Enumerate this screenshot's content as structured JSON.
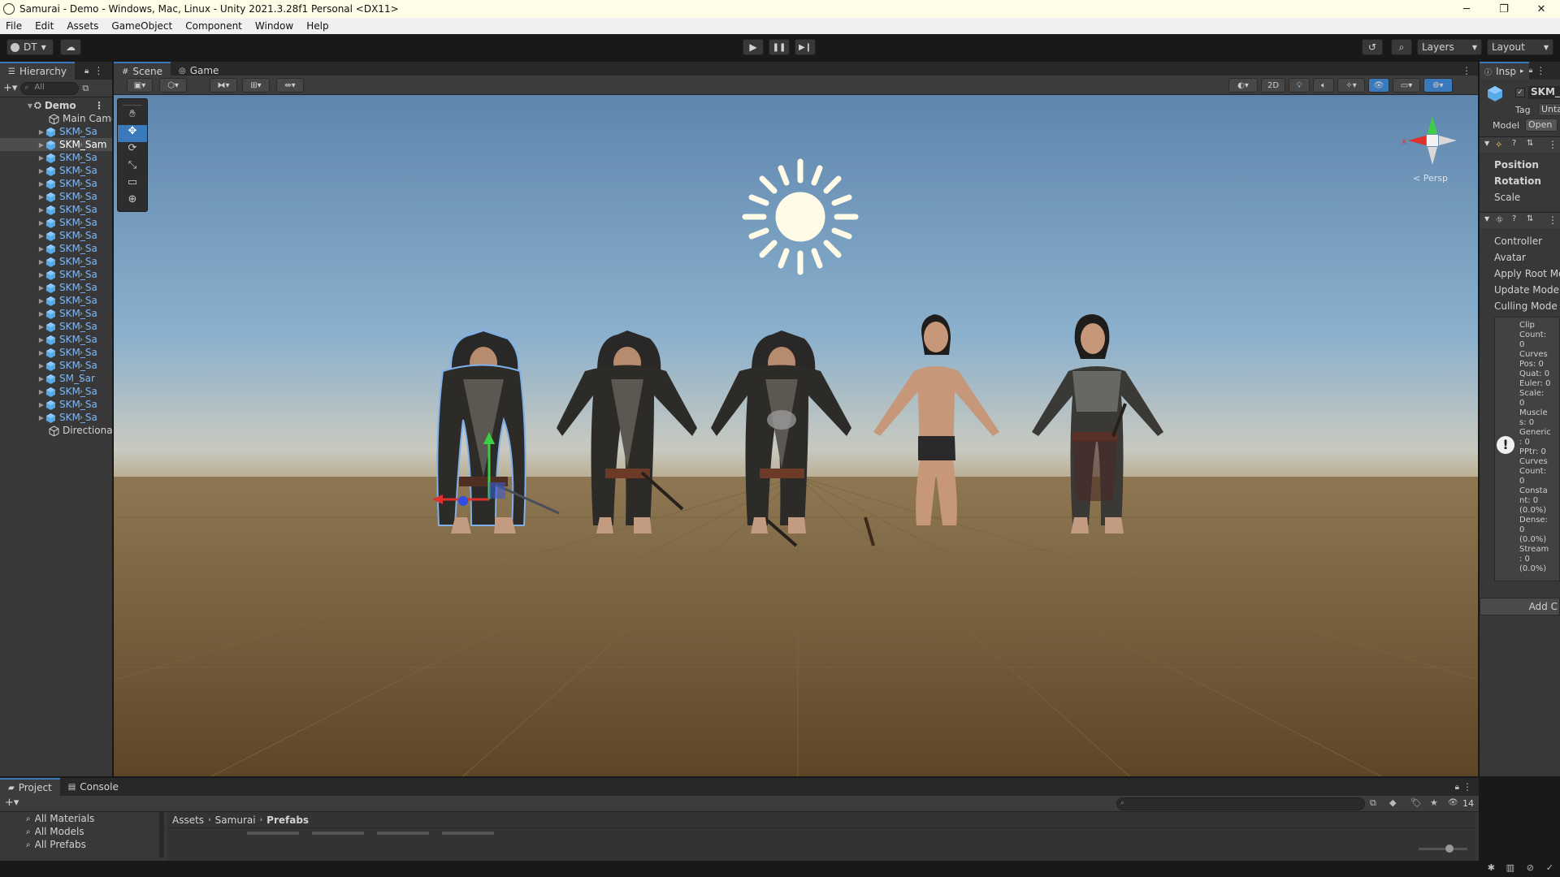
{
  "window": {
    "title": "Samurai - Demo - Windows, Mac, Linux - Unity 2021.3.28f1 Personal <DX11>",
    "controls": [
      "─",
      "❐",
      "✕"
    ]
  },
  "menu": [
    "File",
    "Edit",
    "Assets",
    "GameObject",
    "Component",
    "Window",
    "Help"
  ],
  "toolbar": {
    "account": "DT",
    "layers_label": "Layers",
    "layout_label": "Layout"
  },
  "hierarchy": {
    "tab": "Hierarchy",
    "search_placeholder": "All",
    "root": "Demo",
    "items": [
      {
        "label": "Main Came",
        "type": "object"
      },
      {
        "label": "SKM_Sa",
        "type": "prefab"
      },
      {
        "label": "SKM_Sam",
        "type": "prefab",
        "selected": true
      },
      {
        "label": "SKM_Sa",
        "type": "prefab"
      },
      {
        "label": "SKM_Sa",
        "type": "prefab"
      },
      {
        "label": "SKM_Sa",
        "type": "prefab"
      },
      {
        "label": "SKM_Sa",
        "type": "prefab"
      },
      {
        "label": "SKM_Sa",
        "type": "prefab"
      },
      {
        "label": "SKM_Sa",
        "type": "prefab"
      },
      {
        "label": "SKM_Sa",
        "type": "prefab"
      },
      {
        "label": "SKM_Sa",
        "type": "prefab"
      },
      {
        "label": "SKM_Sa",
        "type": "prefab"
      },
      {
        "label": "SKM_Sa",
        "type": "prefab"
      },
      {
        "label": "SKM_Sa",
        "type": "prefab"
      },
      {
        "label": "SKM_Sa",
        "type": "prefab"
      },
      {
        "label": "SKM_Sa",
        "type": "prefab"
      },
      {
        "label": "SKM_Sa",
        "type": "prefab"
      },
      {
        "label": "SKM_Sa",
        "type": "prefab"
      },
      {
        "label": "SKM_Sa",
        "type": "prefab"
      },
      {
        "label": "SKM_Sa",
        "type": "prefab"
      },
      {
        "label": "SM_Sar",
        "type": "prefab"
      },
      {
        "label": "SKM_Sa",
        "type": "prefab"
      },
      {
        "label": "SKM_Sa",
        "type": "prefab"
      },
      {
        "label": "SKM_Sa",
        "type": "prefab"
      },
      {
        "label": "Directiona",
        "type": "object"
      }
    ]
  },
  "scene": {
    "tabs": [
      "Scene",
      "Game"
    ],
    "toggle_2d": "2D",
    "persp_label": "< Persp",
    "gizmo_axis": "x"
  },
  "inspector": {
    "tab": "Insp",
    "object_name": "SKM_",
    "tag_label": "Tag",
    "tag_value": "Unta",
    "model_label": "Model",
    "model_button": "Open",
    "transform": [
      "Position",
      "Rotation",
      "Scale"
    ],
    "animator": [
      "Controller",
      "Avatar",
      "Apply Root Mo",
      "Update Mode",
      "Culling Mode"
    ],
    "clip_info": [
      "Clip",
      "Count:",
      "0",
      "Curves",
      "Pos: 0",
      "Quat: 0",
      "Euler: 0",
      "Scale:",
      "0",
      "Muscle",
      "s: 0",
      "Generic",
      ": 0",
      "PPtr: 0",
      "Curves",
      "Count:",
      "0",
      "Consta",
      "nt: 0",
      "(0.0%)",
      "Dense:",
      "0",
      "(0.0%)",
      "Stream",
      ": 0",
      "(0.0%)"
    ],
    "add_component": "Add C"
  },
  "project": {
    "tabs": [
      "Project",
      "Console"
    ],
    "favorites": [
      "All Materials",
      "All Models",
      "All Prefabs"
    ],
    "breadcrumb": [
      "Assets",
      "Samurai",
      "Prefabs"
    ],
    "hidden_count": "14"
  }
}
